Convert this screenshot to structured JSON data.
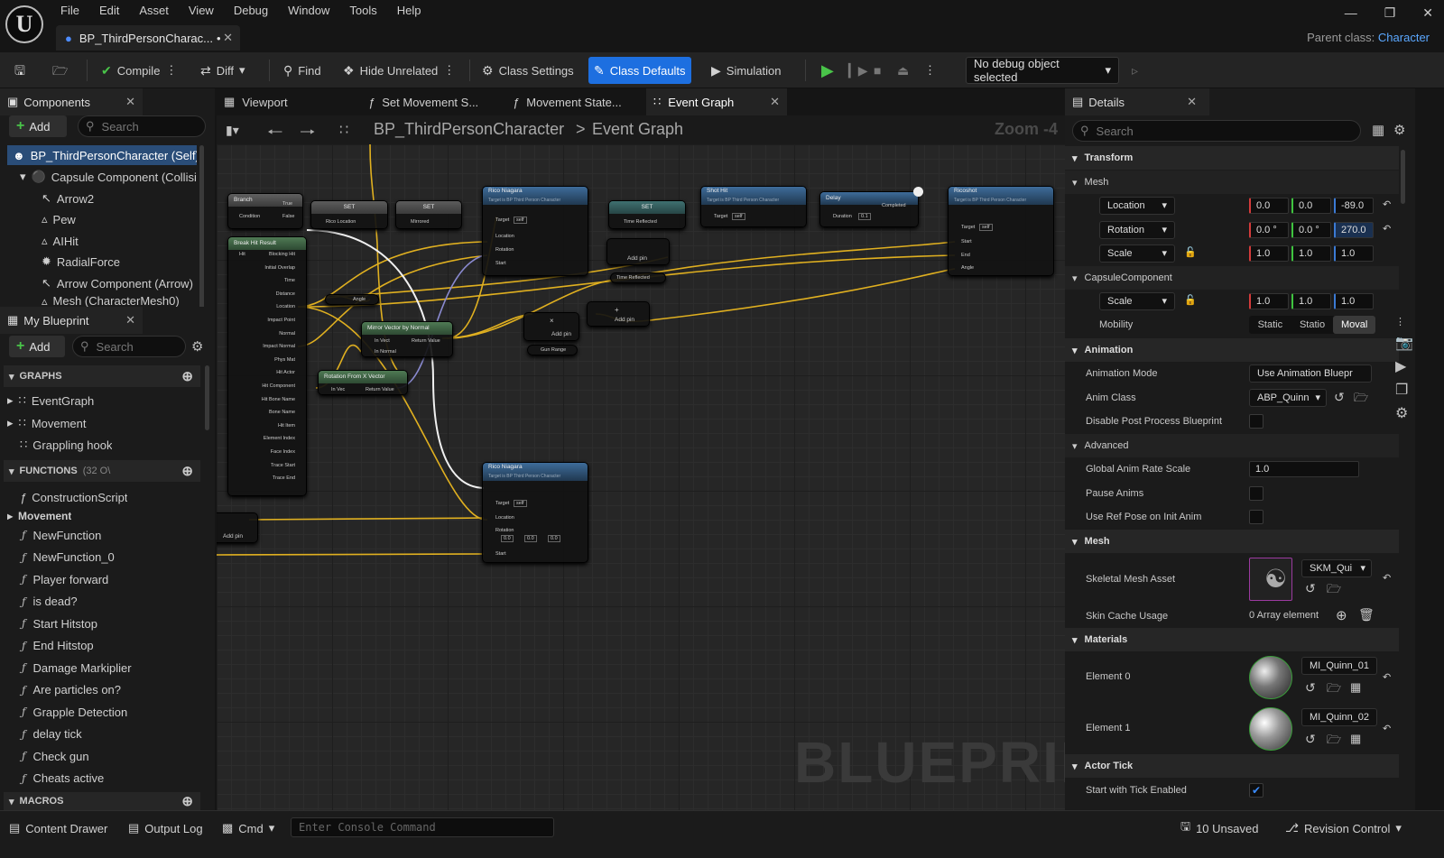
{
  "app": {
    "logo": "U",
    "menu": [
      "File",
      "Edit",
      "Asset",
      "View",
      "Debug",
      "Window",
      "Tools",
      "Help"
    ],
    "doc_tab": "BP_ThirdPersonCharac...",
    "doc_tab_modified": "•",
    "parent_class_label": "Parent class:",
    "parent_class_value": "Character"
  },
  "toolbar": {
    "compile": "Compile",
    "diff": "Diff",
    "find": "Find",
    "hide_unrelated": "Hide Unrelated",
    "class_settings": "Class Settings",
    "class_defaults": "Class Defaults",
    "simulation": "Simulation",
    "debug_object": "No debug object selected"
  },
  "components": {
    "title": "Components",
    "add": "Add",
    "search_placeholder": "Search",
    "items": [
      "BP_ThirdPersonCharacter (Self)",
      "Capsule Component (CollisionCylinder)",
      "Arrow2",
      "Pew",
      "AIHit",
      "RadialForce",
      "Arrow Component (Arrow)",
      "Mesh (CharacterMesh0)"
    ]
  },
  "my_blueprint": {
    "title": "My Blueprint",
    "add": "Add",
    "search_placeholder": "Search",
    "graphs_label": "GRAPHS",
    "graphs": [
      "EventGraph",
      "Movement",
      "Grappling hook"
    ],
    "functions_label": "FUNCTIONS",
    "functions_count": "(32 O\\",
    "construction": "ConstructionScript",
    "movement_group": "Movement",
    "functions": [
      "NewFunction",
      "NewFunction_0",
      "Player forward",
      "is dead?",
      "Start Hitstop",
      "End Hitstop",
      "Damage Markiplier",
      "Are particles on?",
      "Grapple Detection",
      "delay tick",
      "Check gun",
      "Cheats active"
    ],
    "macros_label": "MACROS"
  },
  "graph_tabs": [
    "Viewport",
    "Set Movement S...",
    "Movement State...",
    "Event Graph"
  ],
  "breadcrumb": {
    "root": "BP_ThirdPersonCharacter",
    "sep": ">",
    "current": "Event Graph"
  },
  "zoom": "Zoom -4",
  "watermark": "BLUEPRINT",
  "nodes": {
    "branch": {
      "title": "Branch",
      "pins": [
        "Condition",
        "True",
        "False"
      ]
    },
    "break": {
      "title": "Break Hit Result",
      "pins": [
        "Hit",
        "Blocking Hit",
        "Initial Overlap",
        "Time",
        "Distance",
        "Location",
        "Impact Point",
        "Normal",
        "Impact Normal",
        "Phys Mat",
        "Hit Actor",
        "Hit Component",
        "Hit Bone Name",
        "Bone Name",
        "Hit Item",
        "Element Index",
        "Face Index",
        "Trace Start",
        "Trace End"
      ]
    },
    "set1": {
      "title": "SET",
      "pin": "Rico Location"
    },
    "set2": {
      "title": "SET",
      "pin": "Mirrored"
    },
    "rico1": {
      "title": "Rico Niagara",
      "sub": "Target is BP Third Person Character",
      "pins": [
        "Target",
        "self",
        "Location",
        "Rotation",
        "Start"
      ]
    },
    "set3": {
      "title": "SET",
      "pin": "Time Reflected"
    },
    "shothit": {
      "title": "Shot Hit",
      "sub": "Target is BP Third Person Character",
      "pins": [
        "Target",
        "self"
      ]
    },
    "delay": {
      "title": "Delay",
      "pins": [
        "Duration",
        "0.1",
        "Completed"
      ]
    },
    "ricoshot": {
      "title": "Ricoshot",
      "sub": "Target is BP Third Person Character",
      "pins": [
        "Target",
        "self",
        "Start",
        "End",
        "Angle"
      ]
    },
    "mirror": {
      "title": "Mirror Vector by Normal",
      "pins": [
        "In Vect",
        "In Normal",
        "Return Value"
      ]
    },
    "rotx": {
      "title": "Rotation From X Vector",
      "pins": [
        "In Vec",
        "Return Value"
      ]
    },
    "angle": "Angle",
    "addpin": "Add pin",
    "timereflected": "Time Reflected",
    "gunrange": "Gun Range",
    "rico2": {
      "title": "Rico Niagara",
      "sub": "Target is BP Third Person Character",
      "pins": [
        "Target",
        "self",
        "Location",
        "Rotation",
        "0.0",
        "0.0",
        "0.0",
        "Start"
      ]
    }
  },
  "details": {
    "title": "Details",
    "search_placeholder": "Search",
    "transform": "Transform",
    "mesh_sub": "Mesh",
    "location_label": "Location",
    "location": [
      "0.0",
      "0.0",
      "-89.0"
    ],
    "rotation_label": "Rotation",
    "rotation": [
      "0.0 °",
      "0.0 °",
      "270.0"
    ],
    "scale_label": "Scale",
    "scale": [
      "1.0",
      "1.0",
      "1.0"
    ],
    "capsule_sub": "CapsuleComponent",
    "capsule_scale": [
      "1.0",
      "1.0",
      "1.0"
    ],
    "mobility_label": "Mobility",
    "mobility": [
      "Static",
      "Statio",
      "Moval"
    ],
    "animation": "Animation",
    "anim_mode_label": "Animation Mode",
    "anim_mode": "Use Animation Bluepr",
    "anim_class_label": "Anim Class",
    "anim_class": "ABP_Quinn",
    "disable_pp_label": "Disable Post Process Blueprint",
    "advanced": "Advanced",
    "global_rate_label": "Global Anim Rate Scale",
    "global_rate": "1.0",
    "pause_label": "Pause Anims",
    "ref_pose_label": "Use Ref Pose on Init Anim",
    "mesh": "Mesh",
    "skel_label": "Skeletal Mesh Asset",
    "skel_value": "SKM_Qui",
    "skin_label": "Skin Cache Usage",
    "skin_value": "0 Array element",
    "materials": "Materials",
    "el0_label": "Element 0",
    "el0_value": "MI_Quinn_01",
    "el1_label": "Element 1",
    "el1_value": "MI_Quinn_02",
    "actor_tick": "Actor Tick",
    "tick_label": "Start with Tick Enabled"
  },
  "status": {
    "content_drawer": "Content Drawer",
    "output_log": "Output Log",
    "cmd": "Cmd",
    "console_placeholder": "Enter Console Command",
    "unsaved": "10 Unsaved",
    "revision": "Revision Control"
  }
}
